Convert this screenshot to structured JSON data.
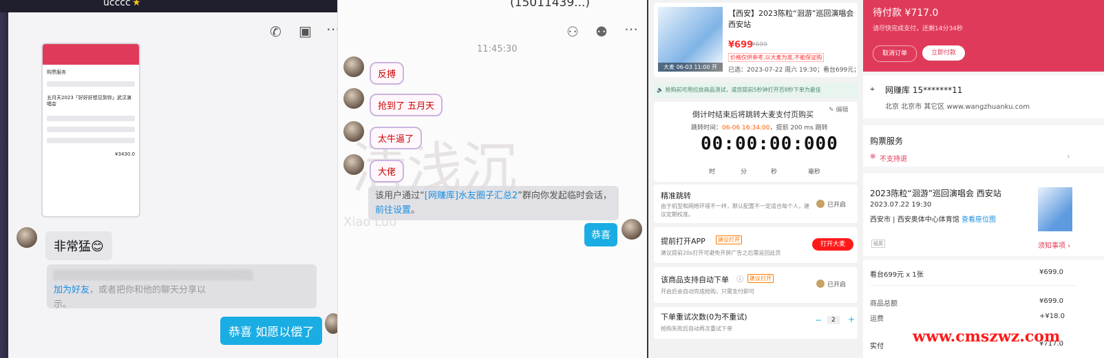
{
  "left_chat": {
    "title": "ucccc",
    "messages": [
      {
        "text": "非常猛",
        "emoji": "😊"
      },
      {
        "text": "恭喜 如愿以偿了"
      }
    ],
    "notice_link1": "加为好友",
    "notice_text1": "，或者把你和他的聊天分享以",
    "notice_text2": "示。",
    "phone": {
      "section": "购票服务",
      "event": "五月天2023「好好好想见到你」武汉演唱会",
      "total": "¥3430.0"
    }
  },
  "mid_chat": {
    "title": "(15011439...)",
    "time": "11:45:30",
    "stickers": [
      "反搏",
      "抢到了 五月天",
      "太牛逼了",
      "大佬"
    ],
    "system_prefix": "该用户通过“",
    "system_link": "[网赚库]水友圈子汇总2",
    "system_mid": "”群向你发起临时会话，",
    "system_link2": "前往设置",
    "system_end": "。",
    "reply": "恭喜",
    "watermark": "Xiao Luo"
  },
  "ticket_tool": {
    "product_title": "【西安】2023陈粒“洄游”巡回演唱会 西安站",
    "price": "¥699",
    "orig_price": "¥699",
    "tag": "价格仅供参考,以大麦为准,不能保证购",
    "selected": "已选：2023-07-22 周六 19:30；看台699元；",
    "poster_caption": "大麦 06-03 11:00 开",
    "notice": "抢购前可用拉拢商品测试，或您提前5秒钟打开百8秒下单为最佳",
    "countdown_title": "倒计时结束后将跳转大麦支付页购买",
    "jump_label": "跳转时间：",
    "jump_time": "06-06 16:34:00",
    "jump_suffix": "，提前 200 ms 跳转",
    "edit": "编辑",
    "timer": "00:00:00:000",
    "units": [
      "时",
      "分",
      "秒",
      "毫秒"
    ],
    "precise": {
      "title": "精准跳转",
      "desc": "由于机型和网络环境不一样，默认配置不一定适合每个人，建议定期校准。",
      "state": "已开启"
    },
    "early": {
      "title": "提前打开APP",
      "badge": "建议打开",
      "desc": "建议提前20s打开可避免开屏广告之后需返回此页",
      "button": "打开大麦"
    },
    "auto": {
      "title": "该商品支持自动下单",
      "badge": "建议打开",
      "desc": "开启后会自动完成抢购，只需支付即可",
      "state": "已开启"
    },
    "retry": {
      "title": "下单重试次数(0为不重试)",
      "desc": "抢购失败后自动再次重试下单",
      "value": "2",
      "minus": "−",
      "plus": "+"
    }
  },
  "order": {
    "pending": "待付款 ¥717.0",
    "hint": "请尽快完成支付，还剩14分34秒",
    "cancel": "取消订单",
    "pay": "立即付款",
    "address_name": "网赚库  15*******11",
    "address": "北京 北京市 其它区 www.wangzhuanku.com",
    "service_title": "购票服务",
    "service_item": "不支持退",
    "event_title": "2023陈粒“洄游”巡回演唱会 西安站",
    "event_time": "2023.07.22 19:30",
    "venue": "西安市 | 西安奥体中心体育馆",
    "venue_link": "查看座位图",
    "ticket_tag": "纸质",
    "notice_link": "须知事项",
    "line1_label": "看台699元 x 1张",
    "line1_value": "¥699.0",
    "line2_label": "商品总额",
    "line2_value": "¥699.0",
    "line3_label": "运费",
    "line3_value": "+¥18.0",
    "line4_label": "实付",
    "line4_value": "¥717.0",
    "watermark": "www.cmszwz.com"
  },
  "colors": {
    "pink": "#e03a5a",
    "blue": "#1aade3",
    "link": "#1a8fe0",
    "red": "#ff2d2d"
  }
}
